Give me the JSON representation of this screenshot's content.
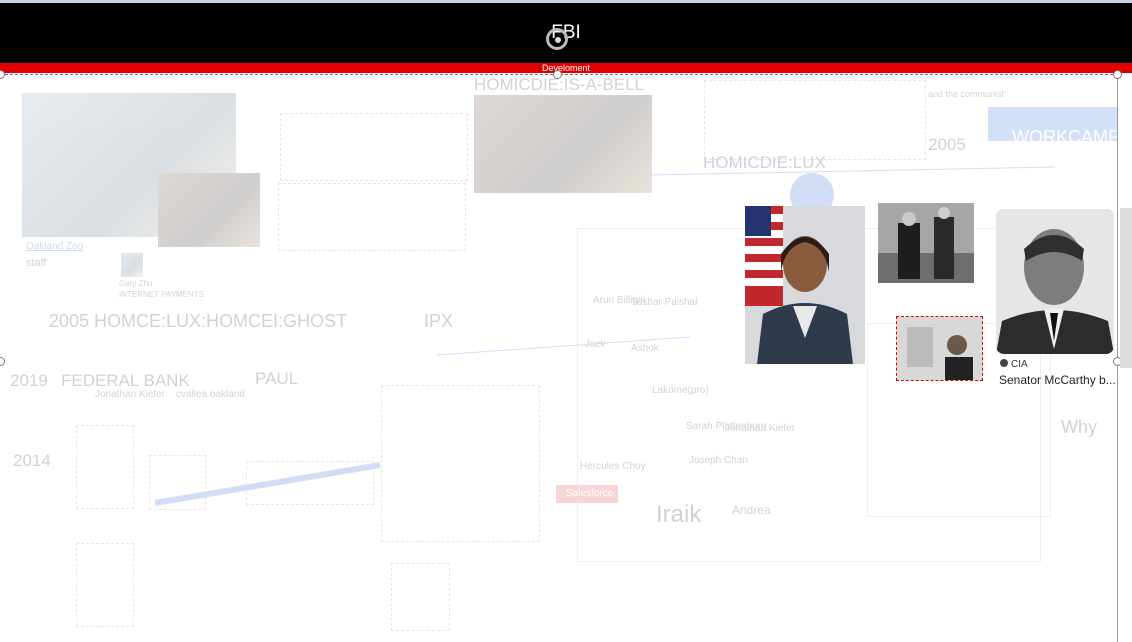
{
  "banner": {
    "title": "FBI",
    "sublabel": "Develoment"
  },
  "canvas": {
    "texts": {
      "homicdie_bell": "HOMICDIE:IS-A-BELL",
      "homicdie_lux": "HOMICDIE:LUX",
      "year_2005_right": "2005",
      "workcamp": "WORKCAMP",
      "communist": "and the communist",
      "oakland_zoo": "Oakland Zoo",
      "staff": "staff",
      "gary_zhu": "Gary Zhu",
      "internet_payments": "INTERNET PAYMENTS",
      "headline_2005": "2005 HOMCE:LUX:HOMCEI:GHOST",
      "ipx": "IPX",
      "year_2019": "2019",
      "federal_bank": "FEDERAL BANK",
      "jonathan_kiefer": "Jonathan Kiefer",
      "cvallea_oakland": "cvallea oakland",
      "paul": "PAUL",
      "year_2014": "2014",
      "arun_billigiri": "Arun Billigiri",
      "tushar_paishal": "Tushar Paishal",
      "jack": "Jack",
      "ashok": "Ashok",
      "lakonerpro": "Lakome(pro)",
      "sarah_plattenburg": "Sarah Plattenburg",
      "jonathan_kiefer_2": "Jonathan Kiefer",
      "joseph_chan": "Joseph Chan",
      "hercules_choy": "Hercules Choy",
      "salesforce": "Salesforce",
      "iraik": "Iraik",
      "andrea": "Andrea",
      "why": "Why"
    }
  },
  "card": {
    "source": "CIA",
    "caption": "Senator McCarthy b..."
  },
  "colors": {
    "banner": "#000000",
    "accent_red": "#e00000"
  },
  "icons": {
    "rotate": "rotate-handle-icon",
    "source": "source-icon"
  }
}
